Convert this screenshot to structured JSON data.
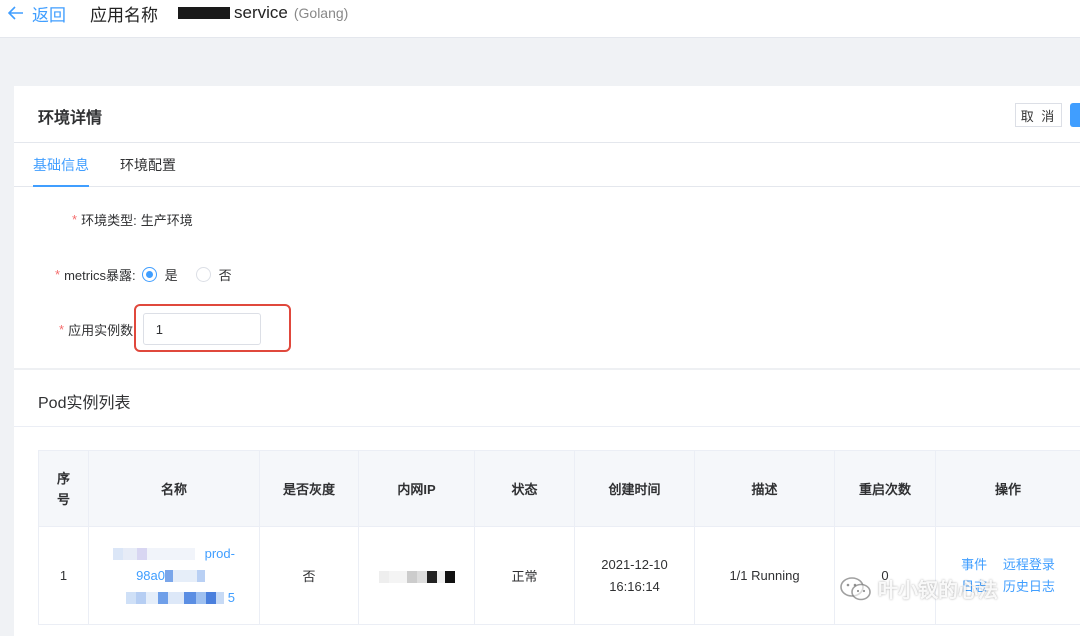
{
  "header": {
    "back_label": "返回",
    "app_name_label": "应用名称",
    "service_name": "service",
    "language": "(Golang)"
  },
  "card": {
    "title": "环境详情",
    "cancel_label": "取 消"
  },
  "tabs": [
    {
      "label": "基础信息",
      "active": true
    },
    {
      "label": "环境配置",
      "active": false
    }
  ],
  "form": {
    "env_type": {
      "label": "环境类型:",
      "value": "生产环境"
    },
    "metrics": {
      "label": "metrics暴露:",
      "options": [
        "是",
        "否"
      ],
      "selected": "是"
    },
    "instances": {
      "label": "应用实例数:",
      "value": "1"
    }
  },
  "pods": {
    "title": "Pod实例列表",
    "columns": [
      "序号",
      "名称",
      "是否灰度",
      "内网IP",
      "状态",
      "创建时间",
      "描述",
      "重启次数",
      "操作"
    ],
    "rows": [
      {
        "index": "1",
        "name_parts": [
          "prod-",
          "98a0",
          "5"
        ],
        "gray": "否",
        "status": "正常",
        "created_date": "2021-12-10",
        "created_time": "16:16:14",
        "desc": "1/1 Running",
        "restarts": "0",
        "actions": [
          "事件",
          "远程登录",
          "日志",
          "历史日志"
        ]
      }
    ]
  },
  "watermark": "叶小钗的心法",
  "colors": {
    "primary": "#409eff",
    "required": "#f56c6c",
    "highlight_box": "#e0483c"
  }
}
